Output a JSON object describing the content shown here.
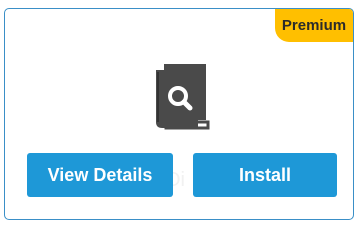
{
  "card": {
    "badge_label": "Premium",
    "watermark_text": "Oi",
    "icon": "book-search-icon",
    "buttons": {
      "view_details_label": "View Details",
      "install_label": "Install"
    }
  },
  "colors": {
    "card_border": "#3a8fc7",
    "badge_background": "#ffbf00",
    "button_background": "#1e98d7",
    "icon_color": "#4a4a4a"
  }
}
